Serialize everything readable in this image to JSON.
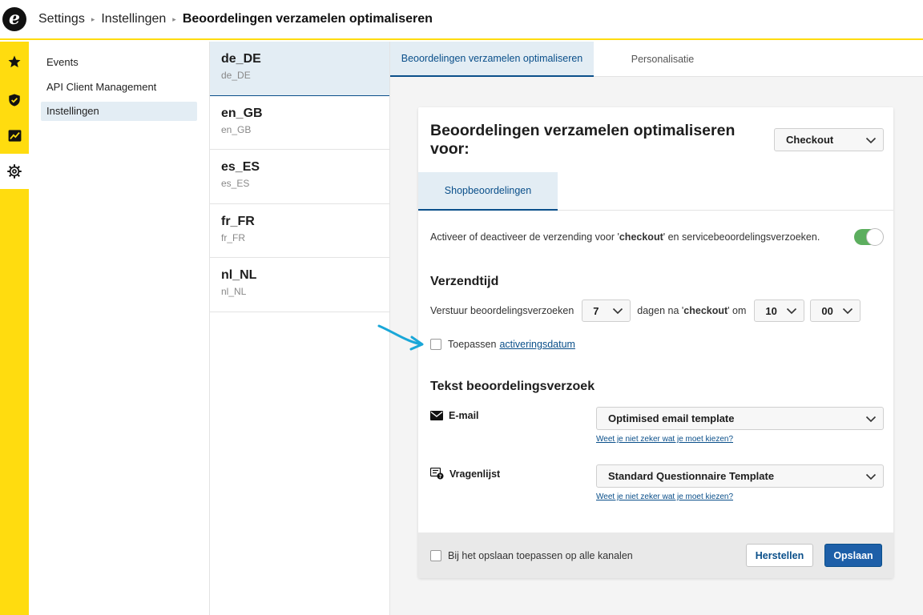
{
  "header": {
    "logo_letter": "e",
    "breadcrumb": [
      "Settings",
      "Instellingen"
    ],
    "breadcrumb_sep": "▸",
    "current": "Beoordelingen verzamelen optimaliseren"
  },
  "rail": {
    "icons": [
      "star-icon",
      "shield-check-icon",
      "chart-icon",
      "gear-icon"
    ],
    "active_index": 3,
    "color": "#ffdc0f"
  },
  "nav": {
    "items": [
      {
        "label": "Events"
      },
      {
        "label": "API Client Management"
      },
      {
        "label": "Instellingen"
      }
    ],
    "active_index": 2
  },
  "locales": [
    {
      "code": "de_DE",
      "sub": "de_DE"
    },
    {
      "code": "en_GB",
      "sub": "en_GB"
    },
    {
      "code": "es_ES",
      "sub": "es_ES"
    },
    {
      "code": "fr_FR",
      "sub": "fr_FR"
    },
    {
      "code": "nl_NL",
      "sub": "nl_NL"
    }
  ],
  "tabs": {
    "optimise": "Beoordelingen verzamelen optimaliseren",
    "personalisation": "Personalisatie"
  },
  "card": {
    "title": "Beoordelingen verzamelen optimaliseren voor:",
    "channel": "Checkout",
    "subtab": "Shopbeoordelingen",
    "toggle": {
      "text_before": "Activeer of deactiveer de verzending voor '",
      "text_bold": "checkout",
      "text_after": "' en servicebeoordelingsverzoeken.",
      "enabled": true
    },
    "send_time": {
      "heading": "Verzendtijd",
      "label": "Verstuur beoordelingsverzoeken",
      "days": "7",
      "after_before": "dagen na '",
      "after_bold": "checkout",
      "after_after": "' om",
      "hour": "10",
      "minute": "00"
    },
    "apply": {
      "label": "Toepassen",
      "link": "activeringsdatum"
    },
    "text_section": {
      "heading": "Tekst beoordelingsverzoek",
      "email_label": "E-mail",
      "email_template": "Optimised email template",
      "hint": "Weet je niet zeker wat je moet kiezen?",
      "questionnaire_label": "Vragenlijst",
      "questionnaire_template": "Standard Questionnaire Template"
    },
    "footer": {
      "apply_all": "Bij het opslaan toepassen op alle kanalen",
      "reset": "Herstellen",
      "save": "Opslaan"
    }
  },
  "colors": {
    "accent_blue": "#0a4f8a",
    "save_button": "#1d5fa8",
    "toggle_on": "#5cae5e",
    "arrow": "#1aa7d8"
  }
}
